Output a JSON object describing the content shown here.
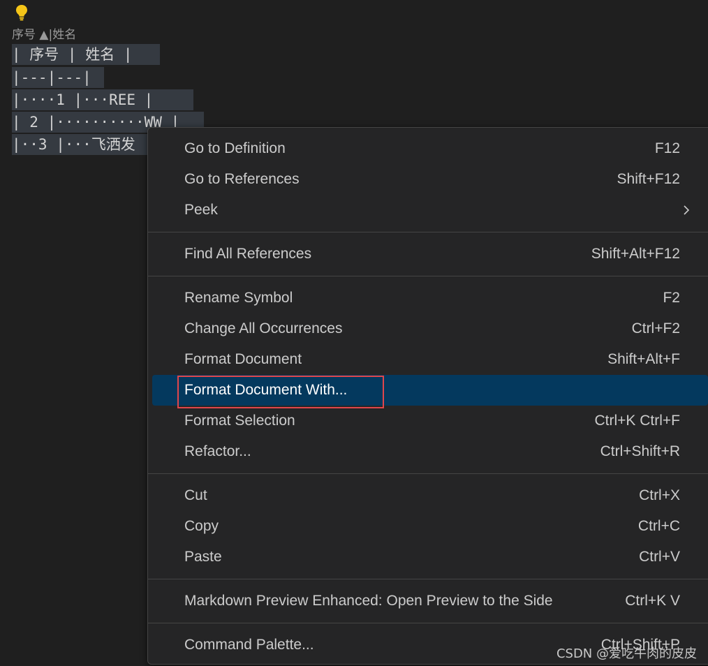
{
  "editor": {
    "codelens": {
      "col1": "序号",
      "sort_arrow": "▲",
      "separator": "|",
      "col2": "姓名"
    },
    "lines": [
      "| 序号 | 姓名 |",
      "|---|---|",
      "|····1 |···REE |",
      "| 2 |··········WW |",
      "|··3 |···飞洒发"
    ]
  },
  "context_menu": {
    "items": {
      "go_to_definition": {
        "label": "Go to Definition",
        "shortcut": "F12"
      },
      "go_to_references": {
        "label": "Go to References",
        "shortcut": "Shift+F12"
      },
      "peek": {
        "label": "Peek",
        "shortcut": ""
      },
      "find_all_references": {
        "label": "Find All References",
        "shortcut": "Shift+Alt+F12"
      },
      "rename_symbol": {
        "label": "Rename Symbol",
        "shortcut": "F2"
      },
      "change_all_occurrences": {
        "label": "Change All Occurrences",
        "shortcut": "Ctrl+F2"
      },
      "format_document": {
        "label": "Format Document",
        "shortcut": "Shift+Alt+F"
      },
      "format_document_with": {
        "label": "Format Document With...",
        "shortcut": ""
      },
      "format_selection": {
        "label": "Format Selection",
        "shortcut": "Ctrl+K Ctrl+F"
      },
      "refactor": {
        "label": "Refactor...",
        "shortcut": "Ctrl+Shift+R"
      },
      "cut": {
        "label": "Cut",
        "shortcut": "Ctrl+X"
      },
      "copy": {
        "label": "Copy",
        "shortcut": "Ctrl+C"
      },
      "paste": {
        "label": "Paste",
        "shortcut": "Ctrl+V"
      },
      "markdown_preview": {
        "label": "Markdown Preview Enhanced: Open Preview to the Side",
        "shortcut": "Ctrl+K V"
      },
      "command_palette": {
        "label": "Command Palette...",
        "shortcut": "Ctrl+Shift+P"
      }
    },
    "active_item": "format_document_with"
  },
  "watermark": "CSDN @爱吃牛肉的皮皮",
  "colors": {
    "background": "#1f1f1f",
    "menu_background": "#252526",
    "active_background": "#04395e",
    "highlight_border": "#e0464b",
    "bulb": "#f5c518"
  },
  "icons": {
    "bulb": "lightbulb-icon",
    "submenu": "chevron-right-icon"
  }
}
